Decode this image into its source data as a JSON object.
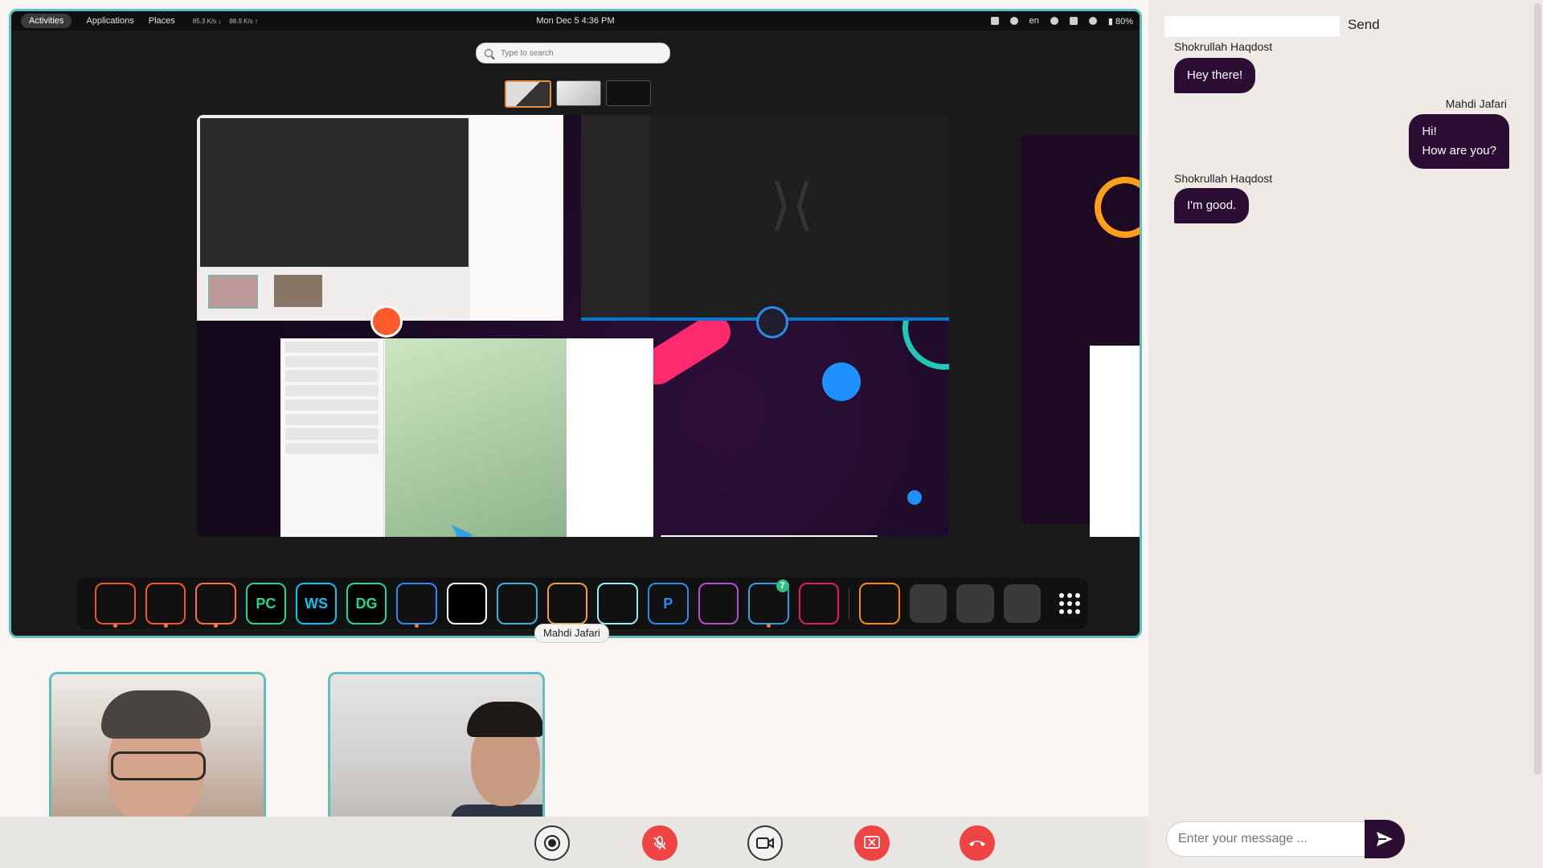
{
  "topbar": {
    "activities": "Activities",
    "applications": "Applications",
    "places": "Places",
    "down_speed": "85.3 K/s ↓",
    "up_speed": "88.9 K/s ↑",
    "clock": "Mon Dec 5   4:36 PM",
    "lang": "en",
    "battery": "80%"
  },
  "overview": {
    "search_placeholder": "Type to search"
  },
  "dock": {
    "items": [
      {
        "name": "files",
        "label": "",
        "color": "#e8582c"
      },
      {
        "name": "brave",
        "label": "",
        "color": "#fb542b"
      },
      {
        "name": "firefox",
        "label": "",
        "color": "#ff7139"
      },
      {
        "name": "pycharm",
        "label": "PC",
        "color": "#21d789"
      },
      {
        "name": "webstorm",
        "label": "WS",
        "color": "#07c3f2"
      },
      {
        "name": "datagrip",
        "label": "DG",
        "color": "#22d88f"
      },
      {
        "name": "vscode",
        "label": "",
        "color": "#2a8cf0"
      },
      {
        "name": "inkscape",
        "label": "",
        "color": "#ffffff"
      },
      {
        "name": "terminal",
        "label": "",
        "color": "#3ab0e0"
      },
      {
        "name": "text-editor",
        "label": "",
        "color": "#e9a23b"
      },
      {
        "name": "electron",
        "label": "",
        "color": "#9feaf9"
      },
      {
        "name": "pgadmin",
        "label": "P",
        "color": "#2a8cf0"
      },
      {
        "name": "calendar",
        "label": "",
        "color": "#b44fd0"
      },
      {
        "name": "telegram",
        "label": "",
        "color": "#2aa3e0",
        "badge": "7"
      },
      {
        "name": "slack",
        "label": "",
        "color": "#e01e5a"
      },
      {
        "name": "vlc",
        "label": "",
        "color": "#ff8800"
      }
    ]
  },
  "presenter_label": "Mahdi Jafari",
  "chat": {
    "send_label": "Send",
    "messages": [
      {
        "author": "Shokrullah Haqdost",
        "text": "Hey there!",
        "side": "left"
      },
      {
        "author": "Mahdi Jafari",
        "line1": "Hi!",
        "line2": "How are you?",
        "side": "right"
      },
      {
        "author": "Shokrullah Haqdost",
        "text": "I'm good.",
        "side": "left"
      }
    ],
    "input_placeholder": "Enter your message ..."
  },
  "colors": {
    "accent_teal": "#5fc0bd",
    "bubble": "#2c0e34",
    "danger": "#ef4444"
  }
}
